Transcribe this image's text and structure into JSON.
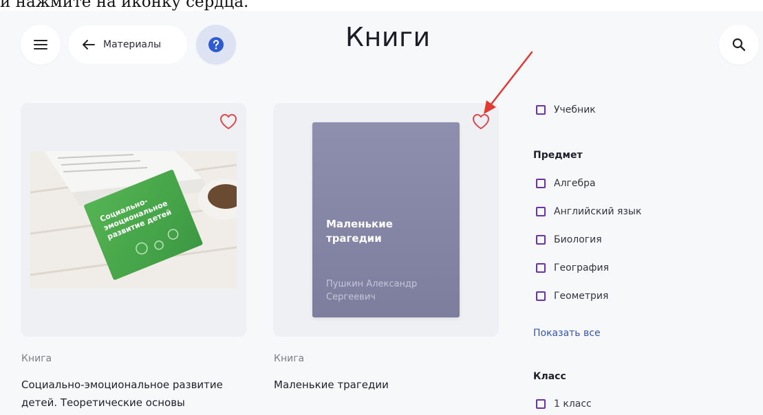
{
  "instruction_text": "и нажмите на иконку сердца.",
  "header": {
    "title": "Книги",
    "back_label": "Материалы",
    "menu_icon": "hamburger-icon",
    "help_icon": "question-icon",
    "search_icon": "search-icon"
  },
  "cards": [
    {
      "kind": "Книга",
      "title_line1": "Социально-эмоциональное развитие",
      "title_line2": "детей. Теоретические основы",
      "image_book_text": "Социально-эмоциональное развитие детей"
    },
    {
      "kind": "Книга",
      "title_line1": "Маленькие трагедии",
      "cover_title": "Маленькие трагедии",
      "cover_author": "Пушкин Александр Сергеевич"
    }
  ],
  "filters": {
    "type_options": [
      "Учебник"
    ],
    "subject_heading": "Предмет",
    "subject_options": [
      "Алгебра",
      "Английский язык",
      "Биология",
      "География",
      "Геометрия"
    ],
    "show_all": "Показать все",
    "class_heading": "Класс",
    "class_options": [
      "1 класс"
    ]
  },
  "colors": {
    "accent_blue": "#2f5bd0",
    "heart_red": "#e0464a",
    "checkbox_purple": "#6b2fb3",
    "link_blue": "#3754a8",
    "arrow_red": "#e03a33"
  }
}
